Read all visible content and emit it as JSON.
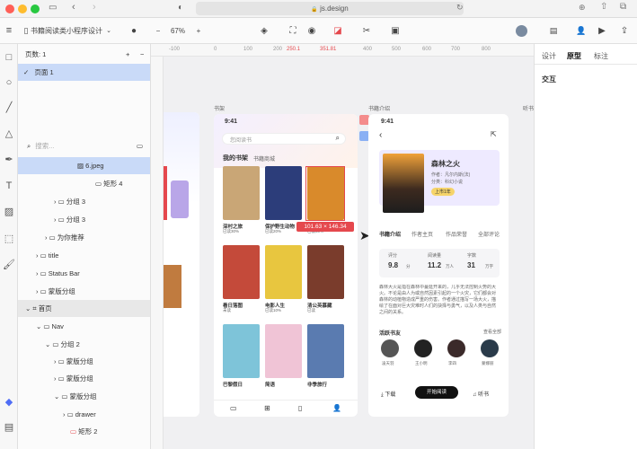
{
  "browser": {
    "url": "js.design",
    "url_lock": "🔒"
  },
  "toolbar": {
    "project_title": "书籍阅读类小程序设计",
    "zoom": "67%",
    "zoom_minus": "−",
    "zoom_plus": "+"
  },
  "layers": {
    "header": "页数: 1",
    "page_item": "页面 1",
    "search_placeholder": "搜索...",
    "items": [
      {
        "label": "6.jpeg"
      },
      {
        "label": "矩形 4"
      },
      {
        "label": "分组 3"
      },
      {
        "label": "分组 3"
      },
      {
        "label": "为你推荐"
      },
      {
        "label": "title"
      },
      {
        "label": "Status Bar"
      },
      {
        "label": "蒙版分组"
      },
      {
        "label": "首页"
      },
      {
        "label": "Nav"
      },
      {
        "label": "分组 2"
      },
      {
        "label": "蒙版分组"
      },
      {
        "label": "蒙版分组"
      },
      {
        "label": "蒙版分组"
      },
      {
        "label": "drawer"
      },
      {
        "label": "矩形 2"
      }
    ]
  },
  "ruler": {
    "ticks": [
      "-100",
      "0",
      "100",
      "200",
      "250.1",
      "351.81",
      "400",
      "500",
      "600",
      "700",
      "800"
    ]
  },
  "canvas": {
    "frame_labels": [
      "书架",
      "书籍介绍",
      "听书"
    ],
    "selection_badge": "101.63 × 146.34",
    "bookshelf": {
      "time": "9:41",
      "search_placeholder": "您阅读书",
      "tabs": [
        "我的书架",
        "书籍商城"
      ],
      "books": [
        {
          "title": "深村之旅",
          "sub": "已读30%"
        },
        {
          "title": "保护野生动物",
          "sub": "已读20%"
        },
        {
          "title": "森林之火",
          "sub": "已读50%"
        },
        {
          "title": "看日落图",
          "sub": "未读"
        },
        {
          "title": "电影人生",
          "sub": "已读10%"
        },
        {
          "title": "清公英慕藏",
          "sub": "已读"
        },
        {
          "title": "巴黎假日",
          "sub": ""
        },
        {
          "title": "简语",
          "sub": ""
        },
        {
          "title": "非季旅行",
          "sub": ""
        }
      ]
    },
    "detail": {
      "time": "9:41",
      "book_title": "森林之火",
      "author": "作者：凡尔内斯(法)",
      "category": "分类：科幻小说",
      "badge": "上市1年",
      "tabs": [
        "书籍介绍",
        "作者主页",
        "作品荣誉",
        "全部评论"
      ],
      "stats": [
        {
          "label": "评分",
          "value": "9.8",
          "unit": "分"
        },
        {
          "label": "阅读量",
          "value": "11.2",
          "unit": "万人"
        },
        {
          "label": "字数",
          "value": "31",
          "unit": "万字"
        }
      ],
      "description": "森林大火是指在森林中蔓延开来的，几乎无法控制火势的大火。不论是由人为或自然因素引起的一个火灾，它们都会对森林的动植物造成严重的伤害。作者通过描写一场大火，描绘了在面对巨大灾难时人们的抉择与勇气，以及人类与自然之间的关系。",
      "readers_title": "活跃书友",
      "readers_more": "查看全部",
      "readers": [
        "凌天羽",
        "王小明",
        "李四",
        "蒙娜丽"
      ],
      "download": "下载",
      "start_reading": "开始阅读",
      "listen": "听书"
    }
  },
  "right_panel": {
    "tabs": [
      "设计",
      "原型",
      "标注"
    ],
    "active_tab": "原型",
    "section": "交互"
  },
  "colors": {
    "accent": "#4f6df5",
    "selection": "#e5484d",
    "layer_selected": "#c9daf8"
  }
}
